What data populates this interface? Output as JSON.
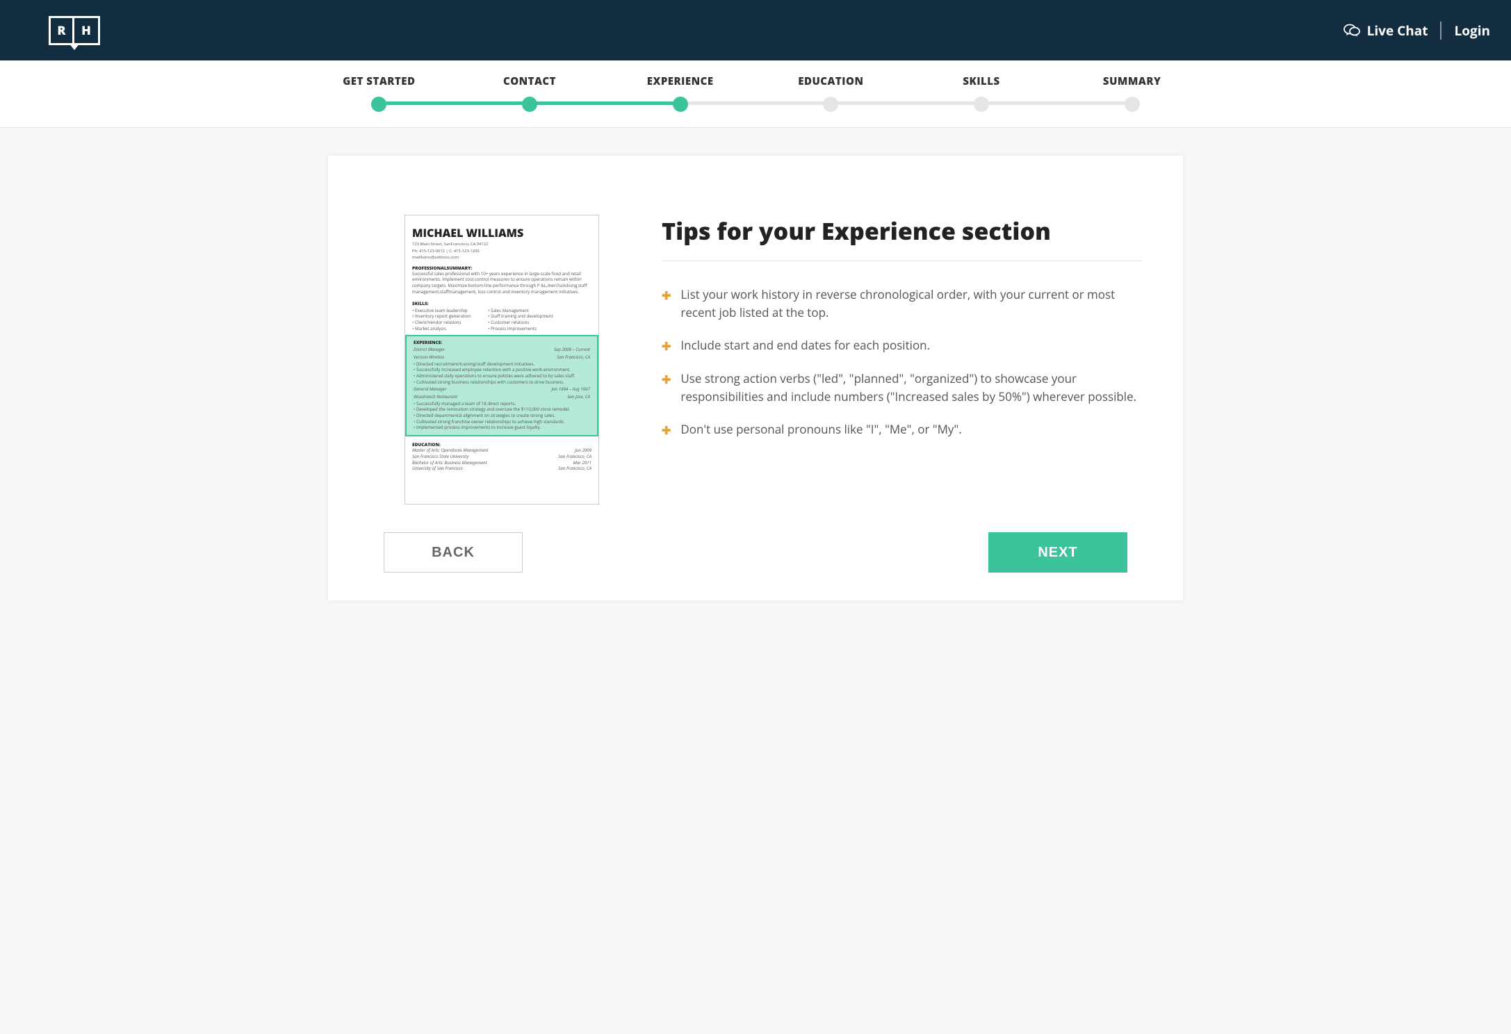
{
  "header": {
    "logo_left": "R",
    "logo_right": "H",
    "live_chat": "Live Chat",
    "login": "Login"
  },
  "stepper": [
    {
      "label": "GET STARTED",
      "active": true,
      "line_active": true
    },
    {
      "label": "CONTACT",
      "active": true,
      "line_active": true
    },
    {
      "label": "EXPERIENCE",
      "active": true,
      "line_active": false
    },
    {
      "label": "EDUCATION",
      "active": false,
      "line_active": false
    },
    {
      "label": "SKILLS",
      "active": false,
      "line_active": false
    },
    {
      "label": "SUMMARY",
      "active": false,
      "line_active": false
    }
  ],
  "tips": {
    "title": "Tips for your Experience section",
    "items": [
      "List your work history in reverse chronological order, with your current or most recent job listed at the top.",
      "Include start and end dates for each position.",
      "Use strong action verbs (\"led\", \"planned\", \"organized\") to showcase your responsibilities and include numbers (\"Increased sales by 50%\") wherever possible.",
      "Don't use personal pronouns like \"I\", \"Me\", or \"My\"."
    ]
  },
  "resume": {
    "name": "MICHAEL WILLIAMS",
    "address": "123 Main Street, SanFrancisco, CA 94122",
    "phone": "Ph: 415-123-0012 | C: 415-123-1200",
    "email": "mwilliams@address.com",
    "summary_head": "PROFESSIONALSUMMARY:",
    "summary_text": "Successful sales professional with 10+ years experience in large-scale food and retail environments. Implement cost control measures to ensure operations remain within company targets. Maximize bottom-line performance through P &L,merchandising,staff management,staffmanagement, loss control and inventory management initiatives.",
    "skills_head": "SKILLS:",
    "skills_left": [
      "Executive team leadership",
      "Inventory report generation",
      "Client/Vendor relations",
      "Market analysis"
    ],
    "skills_right": [
      "Sales Management",
      "Staff training and development",
      "Customer relations",
      "Process improvements"
    ],
    "exp_head": "EXPERIENCE:",
    "jobs": [
      {
        "title": "District Manager",
        "dates": "Sep 2009 – Current",
        "company": "Verizon Wireless",
        "loc": "San Francisco, CA",
        "bullets": [
          "Directed recruitment/training/staff development initiatives.",
          "Successfully increased employee retention with a positive work environment.",
          "Administered daily operations to ensure policies were adhered to by sales staff.",
          "Cultivated strong business relationships with customers to drive business."
        ]
      },
      {
        "title": "General Manager",
        "dates": "Jan 1994 – Aug 1997",
        "company": "Woodranch Restaurant",
        "loc": "San Jose, CA",
        "bullets": [
          "Successfully managed a team of 18 direct reports.",
          "Developed the renovation strategy and oversaw the $110,000 store remodel.",
          "Directed departmental alignment on strategies to create strong sales.",
          "Cultivated strong franchise owner relationships to achieve high standards.",
          "Implemented process improvements to increase guest loyalty."
        ]
      }
    ],
    "edu_head": "EDUCATION:",
    "edu": [
      {
        "deg": "Master of Arts: Operations Management",
        "date": "Jun 2009",
        "school": "San Francisco State University",
        "loc": "San Francisco, CA"
      },
      {
        "deg": "Bachelor of Arts: Business Management",
        "date": "Mar 2011",
        "school": "University of San Francisco",
        "loc": "San Francisco, CA"
      }
    ]
  },
  "buttons": {
    "back": "BACK",
    "next": "NEXT"
  }
}
